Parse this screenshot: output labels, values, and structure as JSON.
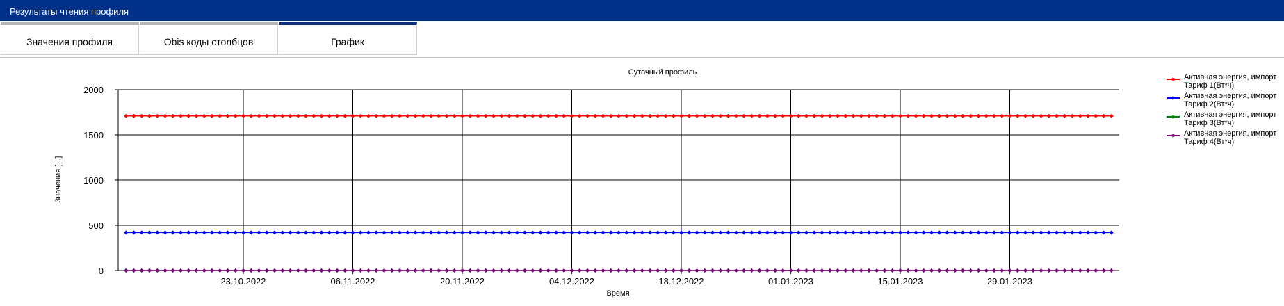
{
  "window": {
    "title": "Результаты чтения профиля"
  },
  "tabs": [
    {
      "label": "Значения профиля",
      "active": false
    },
    {
      "label": "Obis коды столбцов",
      "active": false
    },
    {
      "label": "График",
      "active": true
    }
  ],
  "chart_data": {
    "type": "line",
    "title": "Суточный профиль",
    "xlabel": "Время",
    "ylabel": "Значения [...]",
    "ylim": [
      0,
      2000
    ],
    "yticks": [
      0,
      500,
      1000,
      1500,
      2000
    ],
    "xlim": [
      "2022-10-07",
      "2023-02-12"
    ],
    "xticks": [
      "23.10.2022",
      "06.11.2022",
      "20.11.2022",
      "04.12.2022",
      "18.12.2022",
      "01.01.2023",
      "15.01.2023",
      "29.01.2023"
    ],
    "x_start": "2022-10-08",
    "x_end": "2023-02-11",
    "x_step_days": 1,
    "grid": true,
    "legend_position": "right",
    "series": [
      {
        "name": "Активная энергия, импорт Тариф 1(Вт*ч)",
        "color": "#ff0000",
        "value": 1710
      },
      {
        "name": "Активная энергия, импорт Тариф 2(Вт*ч)",
        "color": "#0000ff",
        "value": 420
      },
      {
        "name": "Активная энергия, импорт Тариф 3(Вт*ч)",
        "color": "#008000",
        "value": 0
      },
      {
        "name": "Активная энергия, импорт Тариф 4(Вт*ч)",
        "color": "#800080",
        "value": 0
      }
    ]
  }
}
